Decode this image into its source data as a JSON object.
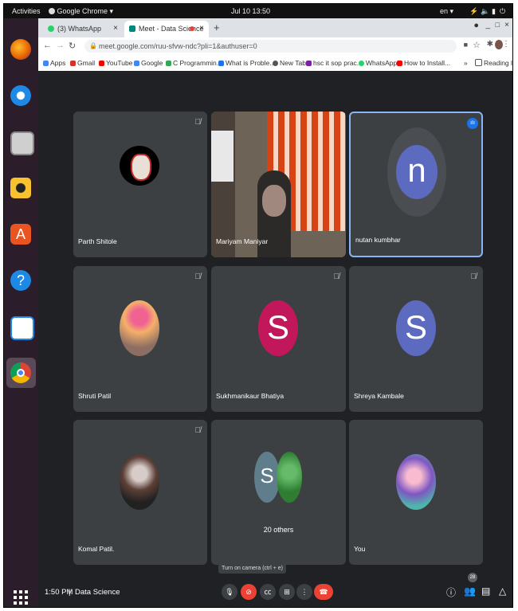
{
  "system": {
    "activities": "Activities",
    "app_menu": "Google Chrome ▾",
    "clock": "Jul 10  13:50",
    "lang": "en ▾",
    "tray_icons": [
      "network-icon",
      "volume-icon",
      "battery-icon",
      "power-icon"
    ]
  },
  "dock": {
    "apps": [
      "firefox",
      "thunderbird",
      "files",
      "rhythmbox",
      "software-center",
      "help",
      "libreoffice-writer",
      "chrome"
    ],
    "grid_icon": "app-grid-icon"
  },
  "browser": {
    "tabs": [
      {
        "title": "(3) WhatsApp",
        "close": "×",
        "active": false
      },
      {
        "title": "Meet - Data Science",
        "close": "×",
        "active": true
      }
    ],
    "new_tab": "+",
    "window_controls": [
      "_",
      "□",
      "×"
    ],
    "url": "meet.google.com/ruu-sfvw-ndc?pli=1&authuser=0",
    "bookmarks": [
      {
        "label": "Apps",
        "color": "#4285f4"
      },
      {
        "label": "Gmail",
        "color": "#d93025"
      },
      {
        "label": "YouTube",
        "color": "#ff0000"
      },
      {
        "label": "Google",
        "color": "#4285f4"
      },
      {
        "label": "C Programmin...",
        "color": "#34a853"
      },
      {
        "label": "What is Proble...",
        "color": "#1a73e8"
      },
      {
        "label": "New Tab",
        "color": "#555555"
      },
      {
        "label": "hsc it sop prac...",
        "color": "#7b1fa2"
      },
      {
        "label": "WhatsApp",
        "color": "#25d366"
      },
      {
        "label": "How to Install...",
        "color": "#ff0000"
      }
    ],
    "more": "»",
    "reading_list": "Reading list"
  },
  "meet": {
    "participants": [
      {
        "name": "Parth Shitole",
        "muted": true,
        "type": "image",
        "color": "#000000"
      },
      {
        "name": "Mariyam Maniyar",
        "muted": false,
        "type": "video",
        "color": ""
      },
      {
        "name": "nutan kumbhar",
        "muted": false,
        "type": "letter",
        "letter": "n",
        "color": "#5c6bc0",
        "speaking": true
      },
      {
        "name": "Shruti Patil",
        "muted": true,
        "type": "image",
        "color": "#c87f5a"
      },
      {
        "name": "Sukhmanikaur Bhatiya",
        "muted": true,
        "type": "letter",
        "letter": "S",
        "color": "#c2185b"
      },
      {
        "name": "Shreya Kambale",
        "muted": true,
        "type": "letter",
        "letter": "S",
        "color": "#5c6bc0"
      },
      {
        "name": "Komal Patil.",
        "muted": true,
        "type": "image",
        "color": "#8d8d8d"
      },
      {
        "name": "",
        "muted": false,
        "type": "others",
        "others_label": "20 others",
        "letter": "S",
        "color": "#607d8b"
      },
      {
        "name": "You",
        "muted": false,
        "type": "image",
        "color": "#b39ddb"
      }
    ],
    "tooltip": "Turn on camera (ctrl + e)",
    "time": "1:50 PM",
    "separator": "|",
    "meeting_title": "Data Science",
    "participant_count": "28",
    "accent": "#8ab4f8",
    "hangup_color": "#ea4335"
  }
}
